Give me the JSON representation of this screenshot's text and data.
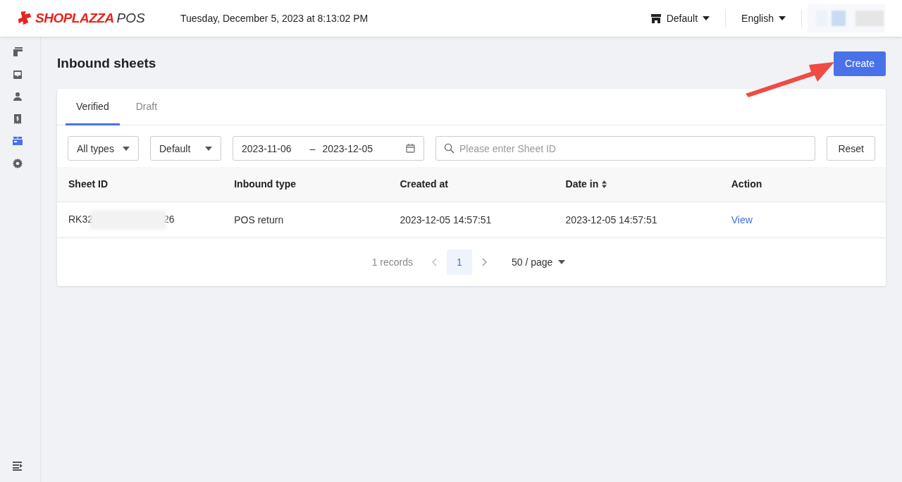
{
  "header": {
    "logo": {
      "brand": "SHOPLAZZA",
      "product": "POS"
    },
    "datetime": "Tuesday, December 5, 2023 at 8:13:02 PM",
    "store": "Default",
    "language": "English"
  },
  "sidebar": {
    "items": [
      {
        "kind": "cards",
        "selected": false
      },
      {
        "kind": "inbox",
        "selected": false
      },
      {
        "kind": "person",
        "selected": false
      },
      {
        "kind": "receipt",
        "selected": false
      },
      {
        "kind": "box",
        "selected": true
      },
      {
        "kind": "gear",
        "selected": false
      }
    ]
  },
  "page": {
    "title": "Inbound sheets",
    "create_button": "Create"
  },
  "tabs": [
    {
      "label": "Verified",
      "selected": true
    },
    {
      "label": "Draft",
      "selected": false
    }
  ],
  "filters": {
    "type": "All types",
    "sort": "Default",
    "date_from": "2023-11-06",
    "date_separator": "–",
    "date_to": "2023-12-05",
    "search": {
      "placeholder": "Please enter Sheet ID"
    },
    "reset": "Reset"
  },
  "table": {
    "columns": [
      {
        "label": "Sheet ID",
        "sortable": false
      },
      {
        "label": "Inbound type",
        "sortable": false
      },
      {
        "label": "Created at",
        "sortable": false
      },
      {
        "label": "Date in",
        "sortable": true
      },
      {
        "label": "Action",
        "sortable": false
      }
    ],
    "rows": [
      {
        "sheet_id_start": "RK32",
        "sheet_id_end": "26",
        "inbound_type": "POS return",
        "created_at": "2023-12-05 14:57:51",
        "date_in": "2023-12-05 14:57:51",
        "action": "View"
      }
    ]
  },
  "pagination": {
    "total": "1 records",
    "pages": [
      {
        "label": "1",
        "selected": true
      }
    ],
    "page_size": "50 / page"
  }
}
